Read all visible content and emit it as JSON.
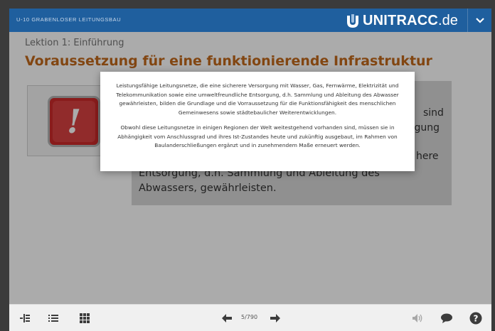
{
  "header": {
    "course_title": "U-10 GRABENLOSER LEITUNGSBAU",
    "logo_name": "UNITRACC",
    "logo_tld": ".de",
    "menu_icon": "chevron-down-icon"
  },
  "lesson": {
    "label": "Lektion 1: Einführung",
    "title": "Voraussetzung für eine funktionierende Infrastruktur"
  },
  "panel": {
    "visible_fragments": [
      "en",
      "sind",
      "rgung",
      "here"
    ],
    "text": "Entsorgung, d.h. Sammlung und Ableitung des Abwassers, gewährleisten."
  },
  "popup": {
    "paragraph1": "Leistungsfähige Leitungsnetze, die eine sicherere Versorgung mit Wasser, Gas, Fernwärme, Elektrizität und Telekommunikation sowie eine umweltfreundliche Entsorgung, d.h. Sammlung und Ableitung des Abwasser gewährleisten, bilden die Grundlage und die Vorraussetzung für die Funktionsfähigkeit des menschlichen Gemeinwesens sowie städtebaulicher Weiterentwicklungen.",
    "paragraph2": "Obwohl diese Leitungsnetze in einigen Regionen der Welt weitestgehend vorhanden sind, müssen sie in Abhängigkeit vom Anschlussgrad und ihres Ist-Zustandes heute und zukünftig ausgebaut, im Rahmen von Baulanderschließungen ergänzt und in zunehmendem Maße erneuert werden."
  },
  "footer": {
    "page_indicator": "5/790",
    "icons": [
      "outline-icon",
      "list-icon",
      "grid-icon",
      "arrow-left-icon",
      "arrow-right-icon",
      "audio-icon",
      "comment-icon",
      "help-icon"
    ]
  },
  "colors": {
    "header_bg": "#1f5f9e",
    "accent_title": "#c2691b",
    "warning_red": "#cc2b2b"
  }
}
